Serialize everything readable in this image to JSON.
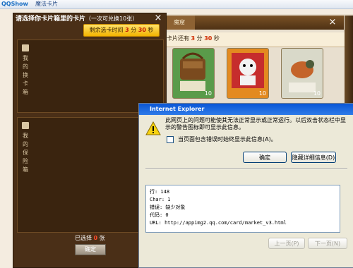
{
  "browser": {
    "logo": "QQShow",
    "tab_title": "魔法卡片"
  },
  "game": {
    "tab_label": "魔窟",
    "close_glyph": "×",
    "banner_prefix": "卡片还有",
    "banner_minutes": "3",
    "banner_mid": "分",
    "banner_seconds": "30",
    "banner_suffix": "秒",
    "cards": [
      {
        "count": "10"
      },
      {
        "count": "10"
      },
      {
        "count": "10"
      }
    ]
  },
  "panel": {
    "title": "请选择你卡片箱里的卡片",
    "title_note": "（一次可兑换10张）",
    "close_glyph": "×",
    "timer_prefix": "剩余选卡时间",
    "timer_minutes": "3",
    "timer_mid": "分",
    "timer_seconds": "30",
    "timer_suffix": "秒",
    "slot1_label": "我的换卡箱",
    "slot2_label": "我的保险箱",
    "selected_prefix": "已选择",
    "selected_count": "0",
    "selected_suffix": "张",
    "confirm_label": "确定"
  },
  "dialog": {
    "title": "Internet Explorer",
    "message": "此网页上的问题可能使其无法正常显示或正常运行。以后双击状态栏中显示的警告图标即可显示此信息。",
    "checkbox_label": "当页面包含错误时始终显示此信息(A)。",
    "ok_label": "确定",
    "hide_details_label": "隐藏详细信息(D)",
    "details": [
      "行:    148",
      "Char: 1",
      "错误: 缺少对象",
      "代码: 0",
      "URL:  http://appimg2.qq.com/card/market_v3.html"
    ],
    "prev_label": "上一页(P)",
    "next_label": "下一页(N)"
  }
}
